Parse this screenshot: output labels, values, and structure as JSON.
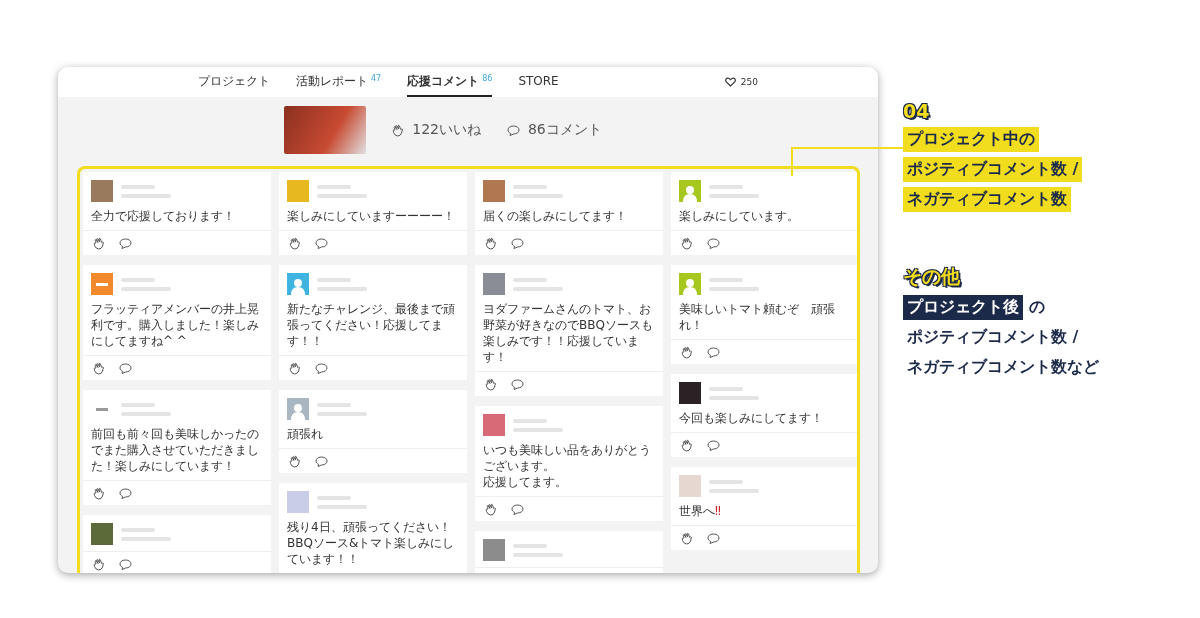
{
  "nav": {
    "tabs": [
      {
        "label": "プロジェクト",
        "selected": false
      },
      {
        "label": "活動レポート",
        "count": "47",
        "selected": false
      },
      {
        "label": "応援コメント",
        "count": "86",
        "selected": true
      },
      {
        "label": "STORE",
        "selected": false
      }
    ],
    "likes": "250"
  },
  "summary": {
    "likes": "122いいね",
    "comments": "86コメント"
  },
  "columns": [
    {
      "cards": [
        {
          "avatar": {
            "kind": "photo",
            "color": "#9a7a5c"
          },
          "text": [
            "全力で応援しております！"
          ]
        },
        {
          "avatar": {
            "kind": "logo",
            "color": "#f08a2c"
          },
          "text": [
            "フラッティアメンバーの井上晃利です。購入しました！楽しみにしてますね^ ^"
          ]
        },
        {
          "avatar": {
            "kind": "logo",
            "color": "#ffffff"
          },
          "text": [
            "前回も前々回も美味しかったのでまた購入させていただきました！楽しみにしています！"
          ]
        },
        {
          "avatar": {
            "kind": "photo",
            "color": "#5c6a3a"
          }
        }
      ]
    },
    {
      "cards": [
        {
          "avatar": {
            "kind": "photo",
            "color": "#e8b820"
          },
          "text": [
            "楽しみにしていますーーーー！"
          ]
        },
        {
          "avatar": {
            "kind": "user",
            "color": "#3fb4e0"
          },
          "text": [
            "新たなチャレンジ、最後まで頑張ってください！応援してます！！"
          ]
        },
        {
          "avatar": {
            "kind": "user",
            "color": "#a9b7c2"
          },
          "text": [
            "頑張れ"
          ]
        },
        {
          "avatar": {
            "kind": "photo",
            "color": "#c9cde8"
          },
          "text": [
            "残り4日、頑張ってください！BBQソース&トマト楽しみにしています！！"
          ]
        }
      ]
    },
    {
      "cards": [
        {
          "avatar": {
            "kind": "photo",
            "color": "#b07850"
          },
          "text": [
            "届くの楽しみにしてます！"
          ]
        },
        {
          "avatar": {
            "kind": "photo",
            "color": "#8a8c96"
          },
          "text": [
            "ヨダファームさんのトマト、お野菜が好きなのでBBQソースも楽しみです！！応援しています！"
          ]
        },
        {
          "avatar": {
            "kind": "photo",
            "color": "#d86a78"
          },
          "text": [
            "いつも美味しい品をありがとうございます。",
            "応援してます。"
          ]
        },
        {
          "avatar": {
            "kind": "photo",
            "color": "#8c8c8c"
          }
        }
      ]
    },
    {
      "cards": [
        {
          "avatar": {
            "kind": "user",
            "color": "#a6c81e"
          },
          "text": [
            "楽しみにしています。"
          ]
        },
        {
          "avatar": {
            "kind": "user",
            "color": "#a6c81e"
          },
          "text": [
            "美味しいトマト頼むぞ　頑張れ！"
          ]
        },
        {
          "avatar": {
            "kind": "photo",
            "color": "#2a2224"
          },
          "text": [
            "今回も楽しみにしてます！"
          ]
        },
        {
          "avatar": {
            "kind": "photo",
            "color": "#e6d8d0"
          },
          "text": [
            "世界へ"
          ],
          "accent": "‼"
        }
      ]
    }
  ],
  "notes": [
    {
      "heading": "04",
      "kind": "highlight",
      "lines": [
        "プロジェクト中の",
        "ポジティブコメント数 /",
        "ネガティブコメント数"
      ]
    },
    {
      "heading": "その他",
      "kind": "plain",
      "tag": "プロジェクト後",
      "tag_rest": "の",
      "lines": [
        "ポジティブコメント数 /",
        "ネガティブコメント数など"
      ]
    }
  ]
}
